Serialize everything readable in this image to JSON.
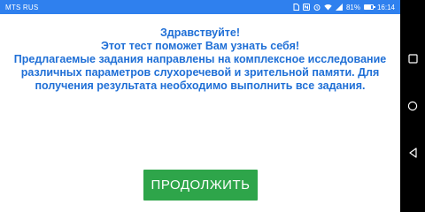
{
  "status_bar": {
    "carrier": "MTS RUS",
    "battery_percent": "81%",
    "battery_level": 0.81,
    "time": "16:14",
    "icons": [
      "sim-icon",
      "nfc-icon",
      "alarm-icon",
      "wifi-icon",
      "signal-icon",
      "battery-icon"
    ]
  },
  "main": {
    "lines": [
      "Здравствуйте!",
      "Этот тест поможет Вам узнать себя!",
      "Предлагаемые задания направлены на комплексное исследование",
      "различных параметров слухоречевой и зрительной памяти. Для",
      "получения результата необходимо выполнить все задания."
    ],
    "continue_label": "ПРОДОЛЖИТЬ"
  },
  "nav_bar": {
    "icons": [
      "recent-apps-icon",
      "home-icon",
      "back-icon"
    ]
  },
  "colors": {
    "status_bar": "#2f80ee",
    "text": "#1f6fd6",
    "button": "#2ea54a",
    "nav_bar": "#000000"
  }
}
